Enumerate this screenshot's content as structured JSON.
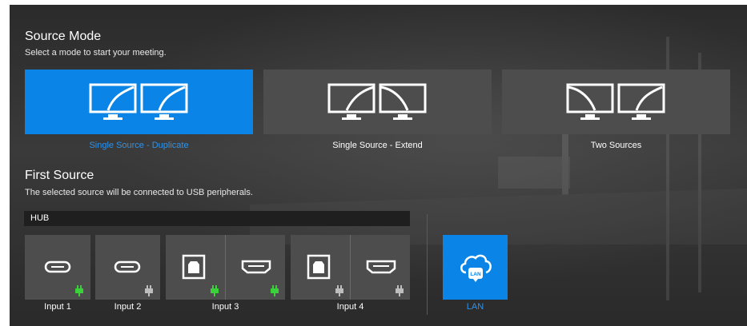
{
  "source_mode": {
    "title": "Source Mode",
    "subtitle": "Select a mode to start your meeting.",
    "modes": [
      {
        "label": "Single Source - Duplicate",
        "selected": true
      },
      {
        "label": "Single Source - Extend",
        "selected": false
      },
      {
        "label": "Two Sources",
        "selected": false
      }
    ]
  },
  "first_source": {
    "title": "First Source",
    "subtitle": "The selected source will be connected to USB peripherals.",
    "hub_label": "HUB",
    "inputs": [
      {
        "label": "Input 1",
        "ports": [
          {
            "icon": "usb-c-icon",
            "connected": true
          }
        ]
      },
      {
        "label": "Input 2",
        "ports": [
          {
            "icon": "usb-c-icon",
            "connected": false
          }
        ]
      },
      {
        "label": "Input 3",
        "ports": [
          {
            "icon": "usb-b-icon",
            "connected": true
          },
          {
            "icon": "hdmi-icon",
            "connected": true
          }
        ]
      },
      {
        "label": "Input 4",
        "ports": [
          {
            "icon": "usb-b-icon",
            "connected": false
          },
          {
            "icon": "hdmi-icon",
            "connected": false
          }
        ]
      }
    ],
    "lan": {
      "label": "LAN",
      "badge": "LAN",
      "icon": "cloud-lan-icon",
      "selected": true
    }
  },
  "colors": {
    "accent": "#0a84e6",
    "connected": "#3ad13a",
    "disconnected": "#bdbdbd",
    "tile": "#4d4d4d"
  }
}
